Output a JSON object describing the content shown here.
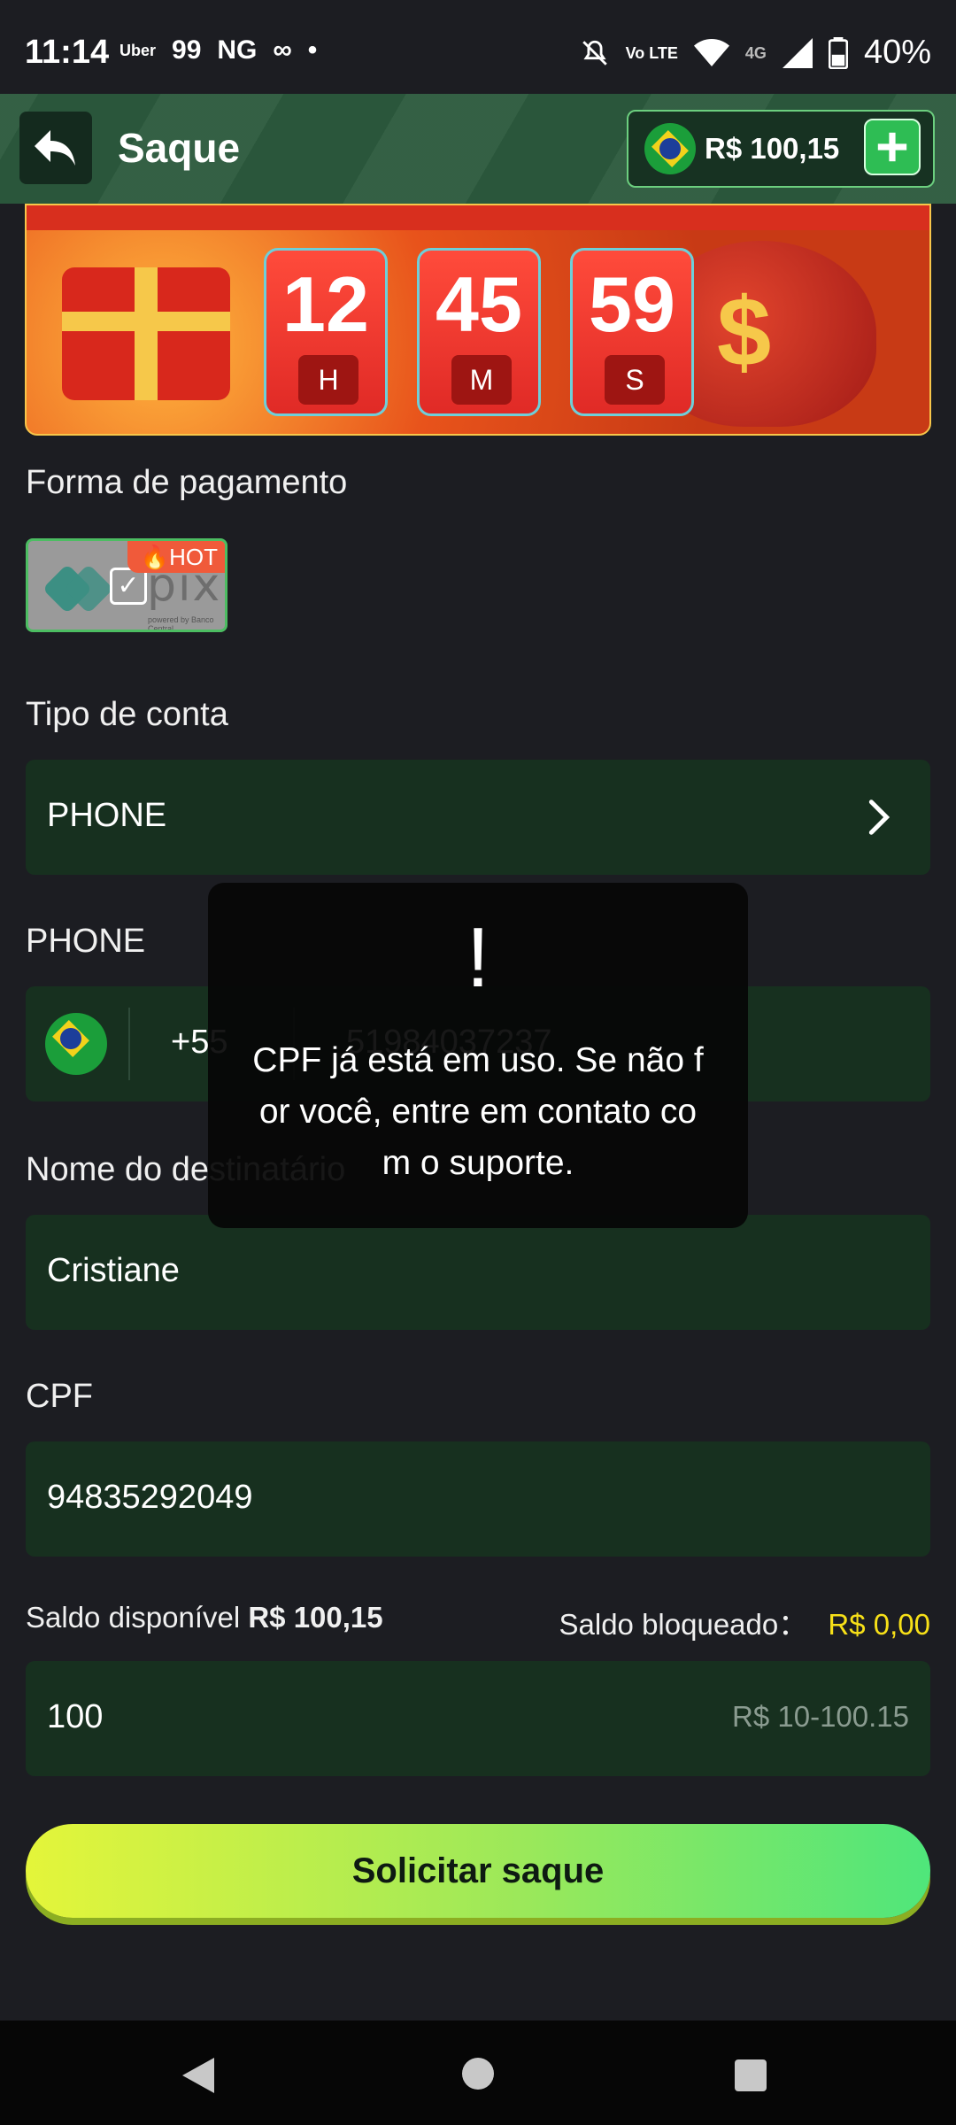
{
  "status_bar": {
    "time": "11:14",
    "apps": [
      "Uber",
      "99",
      "NG",
      "∞",
      "•"
    ],
    "mini_network": "Vo LTE",
    "network_label": "4G",
    "battery": "40%"
  },
  "header": {
    "title": "Saque",
    "balance": "R$ 100,15"
  },
  "timer": {
    "hours": "12",
    "hours_unit": "H",
    "minutes": "45",
    "minutes_unit": "M",
    "seconds": "59",
    "seconds_unit": "S"
  },
  "payment": {
    "label": "Forma de pagamento",
    "method": "pix",
    "method_sub": "powered by Banco Central",
    "badge": "HOT"
  },
  "account_type": {
    "label": "Tipo de conta",
    "value": "PHONE"
  },
  "phone": {
    "label": "PHONE",
    "country_code": "+55",
    "placeholder": "51984037237"
  },
  "recipient": {
    "label": "Nome do destinatário",
    "value": "Cristiane"
  },
  "cpf": {
    "label": "CPF",
    "value": "94835292049"
  },
  "balance_info": {
    "available_label": "Saldo disponível",
    "available_value": "R$ 100,15",
    "blocked_label": "Saldo bloqueado：",
    "blocked_value": "R$ 0,00"
  },
  "amount": {
    "value": "100",
    "range": "R$ 10-100.15"
  },
  "submit_label": "Solicitar saque",
  "toast": {
    "icon": "!",
    "message": "CPF já está em uso. Se não for você, entre em contato com o suporte."
  },
  "colors": {
    "header_bg": "#2c5a3d",
    "field_bg": "#17301f",
    "accent_green": "#2ebd54",
    "blocked_yellow": "#f7e018"
  }
}
